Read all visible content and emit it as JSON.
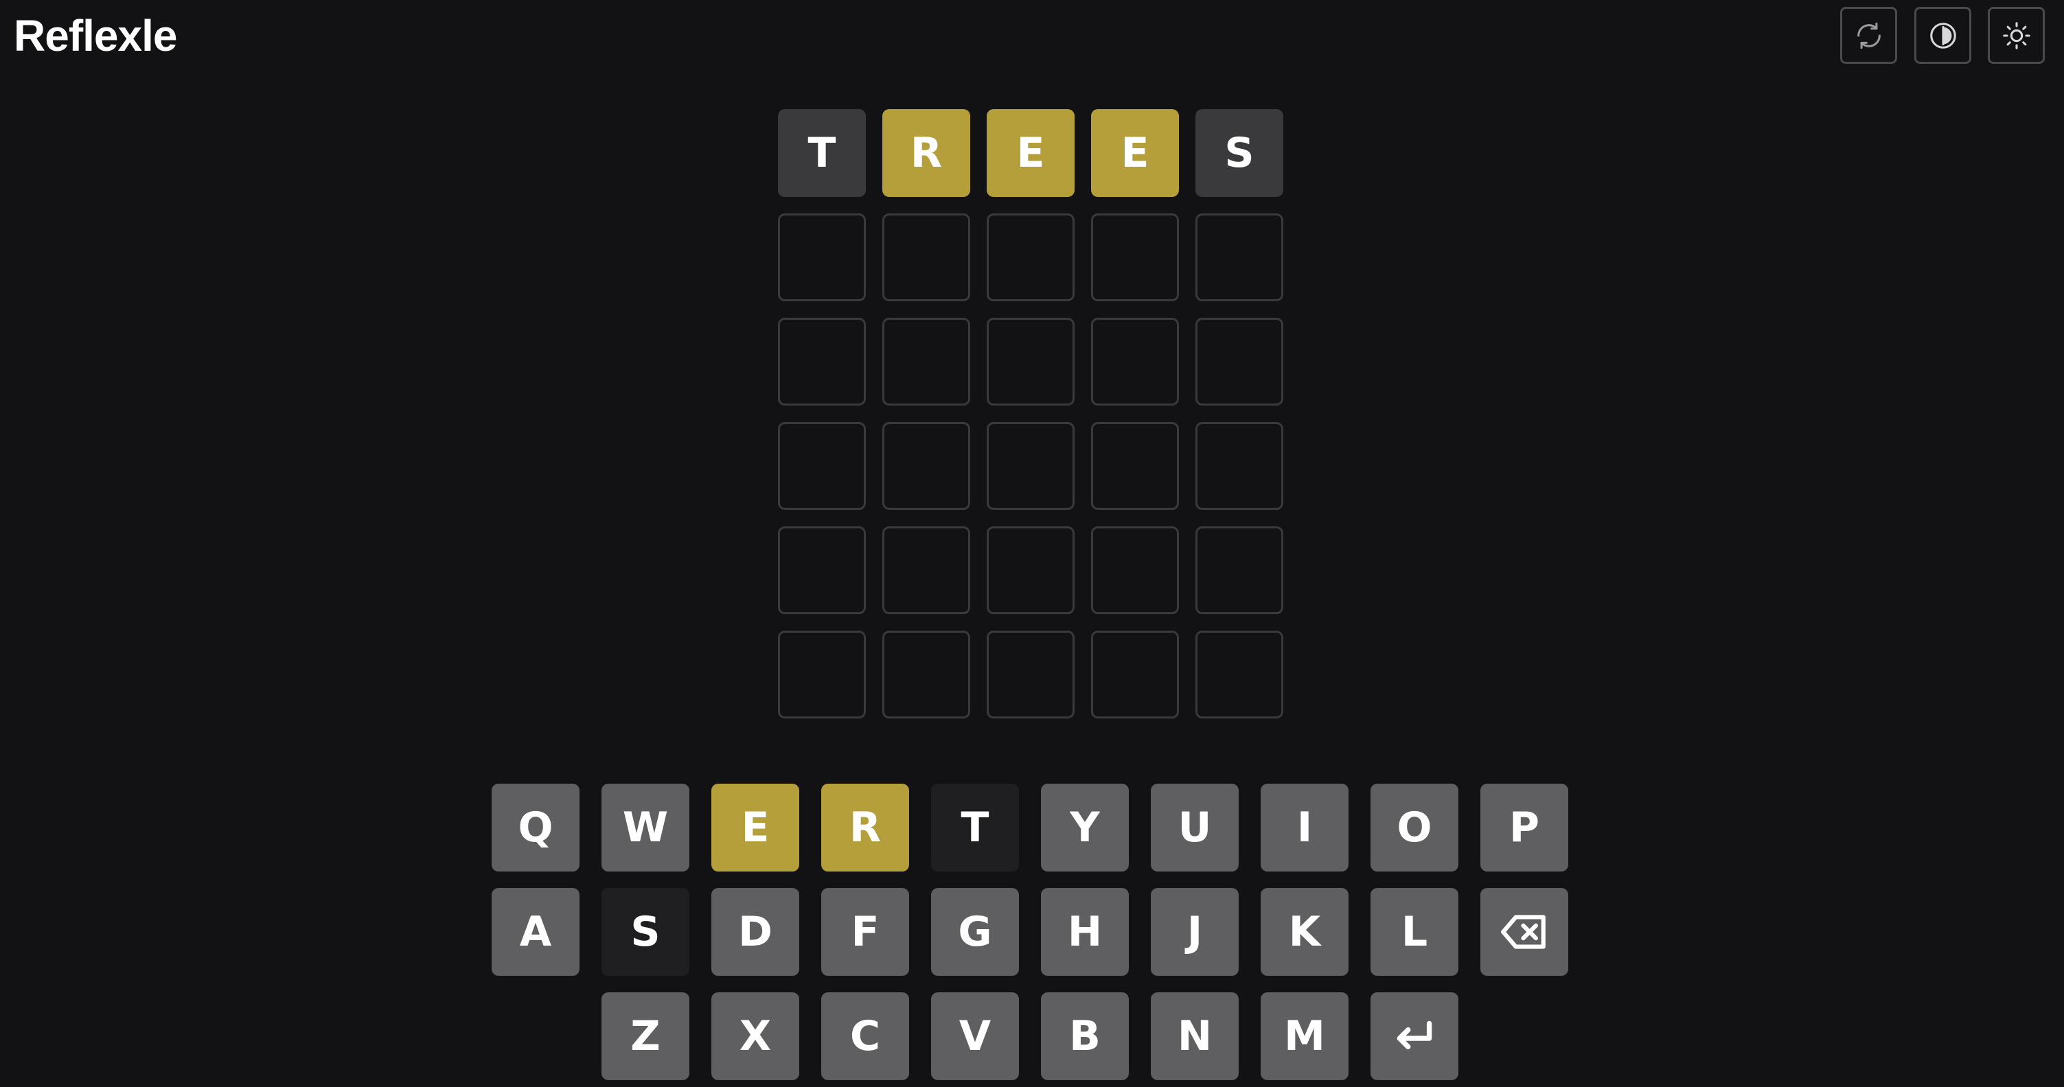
{
  "app": {
    "title": "Reflexle"
  },
  "header_icons": [
    {
      "name": "refresh-icon",
      "label": "refresh"
    },
    {
      "name": "contrast-icon",
      "label": "contrast"
    },
    {
      "name": "theme-icon",
      "label": "theme"
    }
  ],
  "colors": {
    "background": "#121214",
    "present": "#b59f3b",
    "absent_tile": "#3a3a3c",
    "absent_key": "#1f1f21",
    "unused_key": "#5f5f61",
    "empty_border": "#3a3a3e"
  },
  "board": [
    [
      {
        "letter": "T",
        "state": "absent"
      },
      {
        "letter": "R",
        "state": "present"
      },
      {
        "letter": "E",
        "state": "present"
      },
      {
        "letter": "E",
        "state": "present"
      },
      {
        "letter": "S",
        "state": "absent"
      }
    ],
    [
      {
        "letter": "",
        "state": "empty"
      },
      {
        "letter": "",
        "state": "empty"
      },
      {
        "letter": "",
        "state": "empty"
      },
      {
        "letter": "",
        "state": "empty"
      },
      {
        "letter": "",
        "state": "empty"
      }
    ],
    [
      {
        "letter": "",
        "state": "empty"
      },
      {
        "letter": "",
        "state": "empty"
      },
      {
        "letter": "",
        "state": "empty"
      },
      {
        "letter": "",
        "state": "empty"
      },
      {
        "letter": "",
        "state": "empty"
      }
    ],
    [
      {
        "letter": "",
        "state": "empty"
      },
      {
        "letter": "",
        "state": "empty"
      },
      {
        "letter": "",
        "state": "empty"
      },
      {
        "letter": "",
        "state": "empty"
      },
      {
        "letter": "",
        "state": "empty"
      }
    ],
    [
      {
        "letter": "",
        "state": "empty"
      },
      {
        "letter": "",
        "state": "empty"
      },
      {
        "letter": "",
        "state": "empty"
      },
      {
        "letter": "",
        "state": "empty"
      },
      {
        "letter": "",
        "state": "empty"
      }
    ],
    [
      {
        "letter": "",
        "state": "empty"
      },
      {
        "letter": "",
        "state": "empty"
      },
      {
        "letter": "",
        "state": "empty"
      },
      {
        "letter": "",
        "state": "empty"
      },
      {
        "letter": "",
        "state": "empty"
      }
    ]
  ],
  "keyboard": [
    [
      {
        "label": "Q",
        "state": "unused"
      },
      {
        "label": "W",
        "state": "unused"
      },
      {
        "label": "E",
        "state": "present"
      },
      {
        "label": "R",
        "state": "present"
      },
      {
        "label": "T",
        "state": "absent"
      },
      {
        "label": "Y",
        "state": "unused"
      },
      {
        "label": "U",
        "state": "unused"
      },
      {
        "label": "I",
        "state": "unused"
      },
      {
        "label": "O",
        "state": "unused"
      },
      {
        "label": "P",
        "state": "unused"
      }
    ],
    [
      {
        "label": "A",
        "state": "unused"
      },
      {
        "label": "S",
        "state": "absent"
      },
      {
        "label": "D",
        "state": "unused"
      },
      {
        "label": "F",
        "state": "unused"
      },
      {
        "label": "G",
        "state": "unused"
      },
      {
        "label": "H",
        "state": "unused"
      },
      {
        "label": "J",
        "state": "unused"
      },
      {
        "label": "K",
        "state": "unused"
      },
      {
        "label": "L",
        "state": "unused"
      },
      {
        "label": "",
        "state": "unused",
        "icon": "backspace-icon"
      }
    ],
    [
      {
        "label": "Z",
        "state": "unused"
      },
      {
        "label": "X",
        "state": "unused"
      },
      {
        "label": "C",
        "state": "unused"
      },
      {
        "label": "V",
        "state": "unused"
      },
      {
        "label": "B",
        "state": "unused"
      },
      {
        "label": "N",
        "state": "unused"
      },
      {
        "label": "M",
        "state": "unused"
      },
      {
        "label": "",
        "state": "unused",
        "icon": "enter-icon"
      }
    ]
  ]
}
